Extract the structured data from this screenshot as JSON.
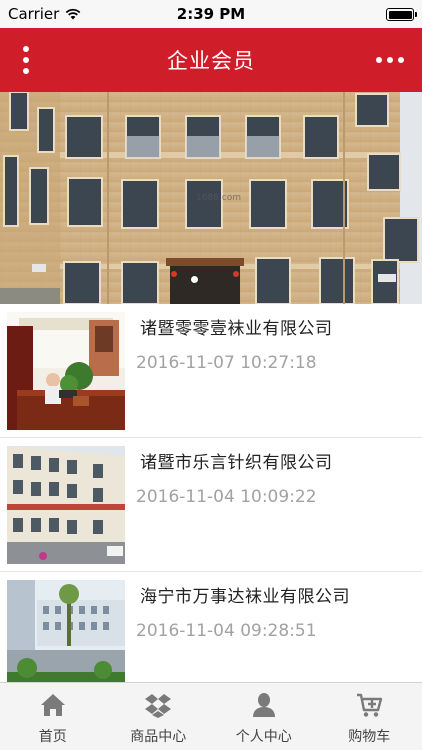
{
  "status_bar": {
    "carrier": "Carrier",
    "time": "2:39 PM",
    "battery_level": 1.0
  },
  "header": {
    "title": "企业会员",
    "left_icon": "vertical-dots-icon",
    "right_icon": "horizontal-dots-icon"
  },
  "banner": {
    "watermark": "1688.com",
    "page_count": 1,
    "active_page": 1
  },
  "companies": [
    {
      "name": "诸暨零零壹袜业有限公司",
      "date": "2016-11-07 10:27:18"
    },
    {
      "name": "诸暨市乐言针织有限公司",
      "date": "2016-11-04 10:09:22"
    },
    {
      "name": "海宁市万事达袜业有限公司",
      "date": "2016-11-04 09:28:51"
    }
  ],
  "tabbar": {
    "tabs": [
      {
        "label": "首页",
        "icon": "home-icon"
      },
      {
        "label": "商品中心",
        "icon": "dropbox-icon"
      },
      {
        "label": "个人中心",
        "icon": "user-icon"
      },
      {
        "label": "购物车",
        "icon": "cart-icon"
      }
    ]
  },
  "colors": {
    "brand_red": "#cf1e29",
    "tab_icon": "#7a7a7a",
    "date_gray": "#a2a2a2"
  }
}
